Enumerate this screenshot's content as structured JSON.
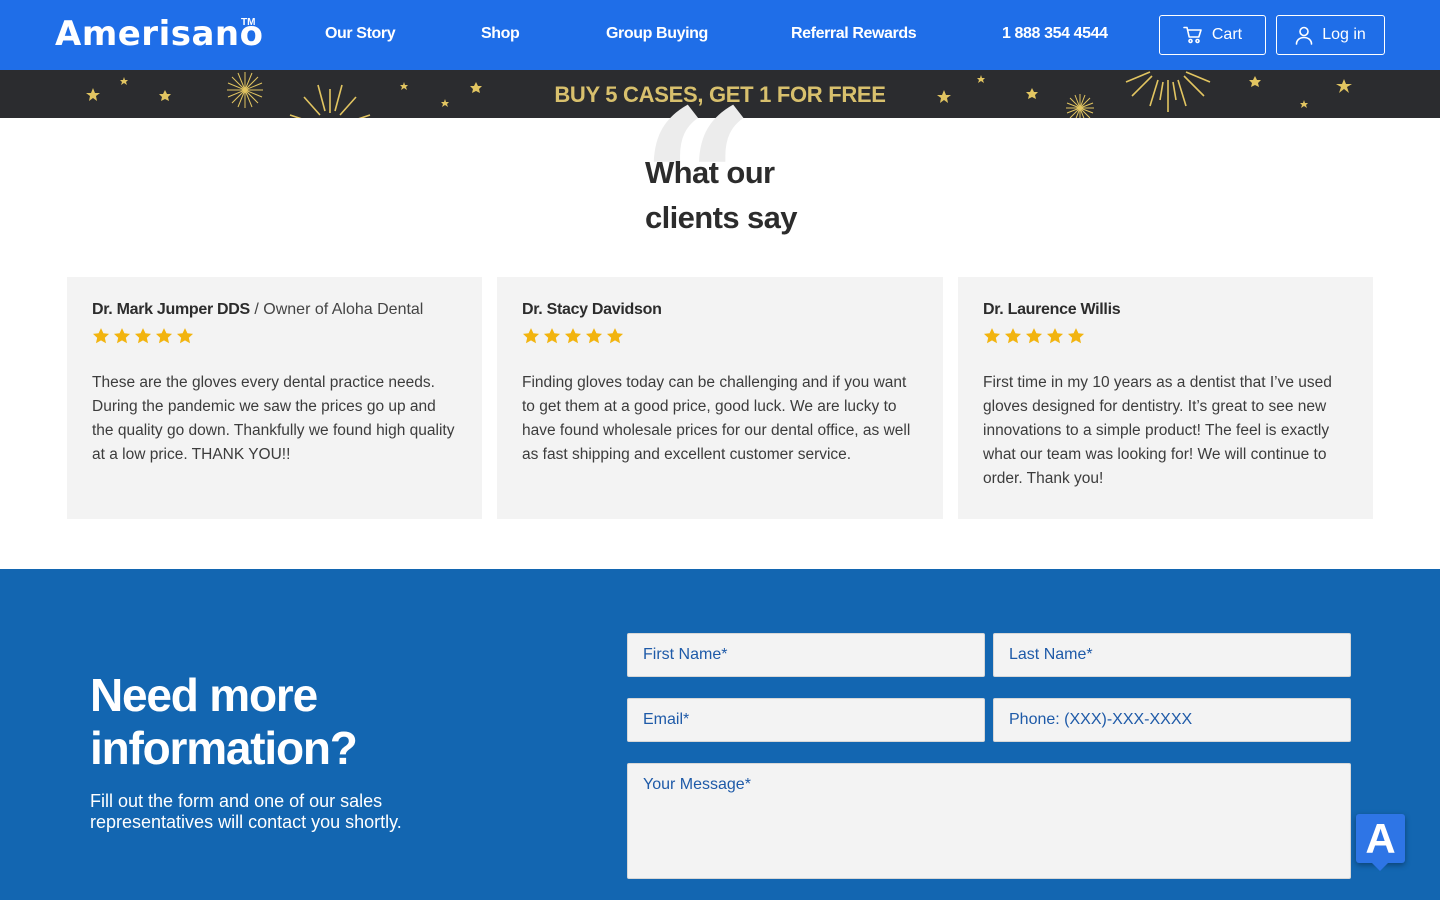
{
  "header": {
    "logo": "Amerisano",
    "logo_tm": "TM",
    "nav": [
      "Our Story",
      "Shop",
      "Group Buying",
      "Referral Rewards",
      "1 888 354 4544"
    ],
    "cart_label": "Cart",
    "login_label": "Log in",
    "icons": {
      "cart": "cart-icon",
      "login": "user-icon"
    },
    "background_color": "#1f6ee8"
  },
  "promo": {
    "text": "BUY 5 CASES, GET 1 FOR FREE",
    "text_color": "#d8c06d",
    "background_color": "#2b2c2f"
  },
  "testimonials": {
    "title_line1": "What our",
    "title_line2": "clients say",
    "quote_glyph": "“",
    "star_color": "#f2b40f",
    "items": [
      {
        "name": "Dr. Mark Jumper DDS",
        "separator": " / ",
        "role": "Owner of Aloha Dental",
        "rating": 5,
        "text": "These are the gloves every dental practice needs. During the pandemic we saw the prices go up and the quality go down. Thankfully we found high quality at a low price. THANK YOU!!"
      },
      {
        "name": "Dr. Stacy Davidson",
        "separator": "",
        "role": "",
        "rating": 5,
        "text": "Finding gloves today can be challenging and if you want to get them at a good price, good luck. We are lucky to have found wholesale prices for our dental office, as well as fast shipping and excellent customer service."
      },
      {
        "name": "Dr. Laurence Willis",
        "separator": "",
        "role": "",
        "rating": 5,
        "text": "First time in my 10 years as a dentist that I’ve used gloves designed for dentistry. It’s great to see new innovations to a simple product! The feel is exactly what our team was looking for! We will continue to order. Thank you!"
      }
    ]
  },
  "contact": {
    "title_line1": "Need more",
    "title_line2": "information?",
    "subtitle": "Fill out the form and one of our sales representatives will contact you shortly.",
    "first_name_placeholder": "First Name*",
    "last_name_placeholder": "Last Name*",
    "email_placeholder": "Email*",
    "phone_placeholder": "Phone: (XXX)-XXX-XXXX",
    "message_placeholder": "Your Message*",
    "background_color": "#1366b1"
  },
  "widget": {
    "label": "A",
    "icon": "accessibility-badge-icon"
  }
}
